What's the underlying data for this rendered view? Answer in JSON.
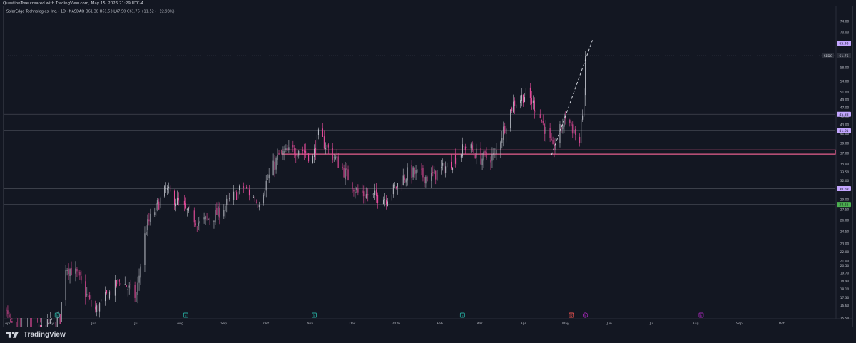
{
  "header": {
    "caption": "QuestionTree created with TradingView.com, May 15, 2026 21:29 UTC-4",
    "symbol_line": "SolarEdge Technologies, Inc. · 1D · NASDAQ",
    "ohlc": [
      {
        "k": "O",
        "v": "61.38"
      },
      {
        "k": "H",
        "v": "61.53"
      },
      {
        "k": "L",
        "v": "47.50"
      },
      {
        "k": "C",
        "v": "61.76"
      },
      {
        "k": "",
        "v": "+11.52 (+22.93%)"
      }
    ]
  },
  "footer": {
    "brand": "TradingView"
  },
  "colors": {
    "background": "#131722",
    "up": "#b2b5be",
    "down": "#e84c9c",
    "grid": "#2a2e39",
    "pivot_high": "#c3a6ff",
    "pivot_low": "#4caf50",
    "support_zone": "#f06292",
    "earnings_past": "#26a69a",
    "earnings_future": "#9c27b0",
    "dividend": "#ef5350"
  },
  "chart_data": {
    "type": "candlestick",
    "title": "SolarEdge Technologies, Inc. · 1D · NASDAQ",
    "ylim": [
      15.54,
      76.5
    ],
    "y_ticks": [
      "74.00",
      "70.00",
      "66.00",
      "62.00",
      "58.00",
      "54.00",
      "51.00",
      "49.00",
      "47.00",
      "45.00",
      "43.00",
      "41.00",
      "39.00",
      "37.00",
      "35.00",
      "33.50",
      "32.00",
      "30.50",
      "29.00",
      "27.50",
      "26.00",
      "24.50",
      "23.00",
      "22.00",
      "21.00",
      "20.50",
      "19.70",
      "18.90",
      "18.10",
      "17.30",
      "16.60",
      "15.54"
    ],
    "x_ticks": [
      {
        "label": "Apr",
        "date": "2025-04-01"
      },
      {
        "label": "May",
        "date": "2025-05-01"
      },
      {
        "label": "Jun",
        "date": "2025-06-01"
      },
      {
        "label": "Jul",
        "date": "2025-07-01"
      },
      {
        "label": "Aug",
        "date": "2025-08-01"
      },
      {
        "label": "Sep",
        "date": "2025-09-01"
      },
      {
        "label": "Oct",
        "date": "2025-10-01"
      },
      {
        "label": "Nov",
        "date": "2025-11-01"
      },
      {
        "label": "Dec",
        "date": "2025-12-01"
      },
      {
        "label": "2026",
        "date": "2026-01-01"
      },
      {
        "label": "Feb",
        "date": "2026-02-01"
      },
      {
        "label": "Mar",
        "date": "2026-03-01"
      },
      {
        "label": "Apr",
        "date": "2026-04-01"
      },
      {
        "label": "May",
        "date": "2026-05-01"
      },
      {
        "label": "Jun",
        "date": "2026-06-01"
      },
      {
        "label": "Jul",
        "date": "2026-07-01"
      },
      {
        "label": "Aug",
        "date": "2026-08-01"
      },
      {
        "label": "Sep",
        "date": "2026-09-01"
      },
      {
        "label": "Oct",
        "date": "2026-10-01"
      }
    ],
    "x_range": [
      "2025-03-29",
      "2026-11-08"
    ],
    "anchors": [
      [
        "2025-03-28",
        16.8
      ],
      [
        "2025-04-08",
        13.5
      ],
      [
        "2025-04-22",
        14.5
      ],
      [
        "2025-05-08",
        15.5
      ],
      [
        "2025-05-12",
        20.5
      ],
      [
        "2025-05-20",
        19.5
      ],
      [
        "2025-06-01",
        16.0
      ],
      [
        "2025-06-20",
        19.0
      ],
      [
        "2025-07-01",
        17.3
      ],
      [
        "2025-07-08",
        25.0
      ],
      [
        "2025-07-22",
        30.5
      ],
      [
        "2025-08-04",
        27.5
      ],
      [
        "2025-08-15",
        25.5
      ],
      [
        "2025-08-28",
        27.0
      ],
      [
        "2025-09-15",
        31.0
      ],
      [
        "2025-09-25",
        28.5
      ],
      [
        "2025-10-10",
        36.5
      ],
      [
        "2025-10-25",
        38.0
      ],
      [
        "2025-11-03",
        36.0
      ],
      [
        "2025-11-07",
        40.5
      ],
      [
        "2025-11-20",
        35.5
      ],
      [
        "2025-12-05",
        30.0
      ],
      [
        "2025-12-15",
        29.5
      ],
      [
        "2025-12-25",
        29.2
      ],
      [
        "2026-01-10",
        33.5
      ],
      [
        "2026-01-25",
        32.5
      ],
      [
        "2026-02-08",
        35.0
      ],
      [
        "2026-02-20",
        38.5
      ],
      [
        "2026-03-02",
        36.0
      ],
      [
        "2026-03-12",
        36.5
      ],
      [
        "2026-03-25",
        48.0
      ],
      [
        "2026-04-03",
        50.5
      ],
      [
        "2026-04-10",
        47.0
      ],
      [
        "2026-04-22",
        37.5
      ],
      [
        "2026-05-01",
        45.0
      ],
      [
        "2026-05-07",
        41.5
      ],
      [
        "2026-05-11",
        39.0
      ],
      [
        "2026-05-14",
        50.2
      ],
      [
        "2026-05-15",
        61.76
      ]
    ],
    "horizontal_lines": [
      {
        "price": 65.93,
        "label": "65.93",
        "kind": "pivot_high"
      },
      {
        "price": 45.38,
        "label": "45.38",
        "kind": "pivot_high"
      },
      {
        "price": 41.61,
        "label": "41.61",
        "kind": "pivot_high"
      },
      {
        "price": 30.69,
        "label": "30.69",
        "kind": "pivot_high"
      },
      {
        "price": 28.25,
        "label": "28.25",
        "kind": "pivot_low"
      }
    ],
    "support_zone": {
      "low": 36.8,
      "high": 37.6,
      "from": "2025-10-12"
    },
    "trend_line": {
      "from": [
        "2026-04-21",
        36.6
      ],
      "to": [
        "2026-05-20",
        67.0
      ]
    },
    "last_price": {
      "tag": "SEDG",
      "value": "61.76"
    },
    "events": [
      {
        "date": "2025-05-06",
        "type": "earnings",
        "label": "E"
      },
      {
        "date": "2025-08-05",
        "type": "earnings",
        "label": "E"
      },
      {
        "date": "2025-11-04",
        "type": "earnings",
        "label": "E"
      },
      {
        "date": "2026-02-17",
        "type": "earnings",
        "label": "E"
      },
      {
        "date": "2026-05-05",
        "type": "dividend",
        "label": "D"
      },
      {
        "date": "2026-05-15",
        "type": "earnings_future",
        "label": "E"
      },
      {
        "date": "2026-08-05",
        "type": "earnings_future",
        "label": "E"
      }
    ]
  }
}
